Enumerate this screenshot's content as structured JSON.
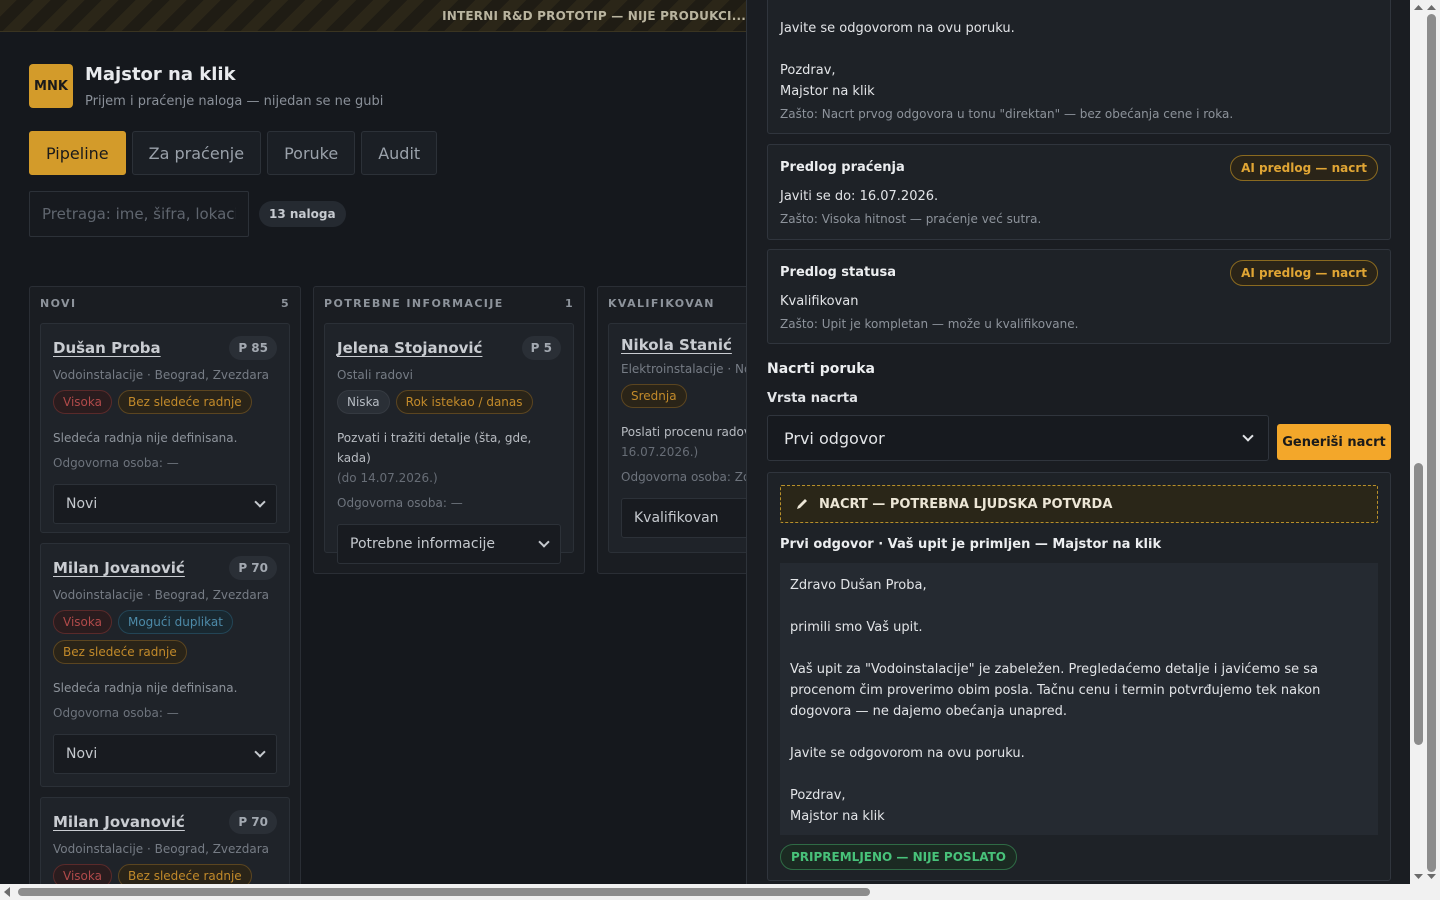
{
  "banner": {
    "text": "INTERNI R&D PROTOTIP — NIJE PRODUKCI..."
  },
  "header": {
    "logo": "MNK",
    "title": "Majstor na klik",
    "subtitle": "Prijem i praćenje naloga — nijedan se ne gubi"
  },
  "tabs": [
    {
      "label": "Pipeline",
      "active": true
    },
    {
      "label": "Za praćenje",
      "active": false
    },
    {
      "label": "Poruke",
      "active": false
    },
    {
      "label": "Audit",
      "active": false
    }
  ],
  "search": {
    "placeholder": "Pretraga: ime, šifra, lokaci",
    "count": "13 naloga"
  },
  "columns": [
    {
      "title": "NOVI",
      "count": "5",
      "cards": [
        {
          "name": "Dušan Proba",
          "priority": "P 85",
          "meta": "Vodoinstalacije · Beograd, Zvezdara",
          "tags": [
            {
              "label": "Visoka",
              "color": "#b04a4a"
            },
            {
              "label": "Bez sledeće radnje",
              "color": "#c28a2a"
            }
          ],
          "next": "Sledeća radnja nije definisana.",
          "owner": "Odgovorna osoba: —",
          "status": "Novi"
        },
        {
          "name": "Milan Jovanović",
          "priority": "P 70",
          "meta": "Vodoinstalacije · Beograd, Zvezdara",
          "tags": [
            {
              "label": "Visoka",
              "color": "#b04a4a"
            },
            {
              "label": "Mogući duplikat",
              "color": "#4d8aa8"
            },
            {
              "label": "Bez sledeće radnje",
              "color": "#c28a2a"
            }
          ],
          "next": "Sledeća radnja nije definisana.",
          "owner": "Odgovorna osoba: —",
          "status": "Novi"
        },
        {
          "name": "Milan Jovanović",
          "priority": "P 70",
          "meta": "Vodoinstalacije · Beograd, Zvezdara",
          "tags": [
            {
              "label": "Visoka",
              "color": "#b04a4a"
            },
            {
              "label": "Bez sledeće radnje",
              "color": "#c28a2a"
            }
          ]
        }
      ]
    },
    {
      "title": "POTREBNE INFORMACIJE",
      "count": "1",
      "cards": [
        {
          "name": "Jelena Stojanović",
          "priority": "P 5",
          "meta": "Ostali radovi",
          "tags": [
            {
              "label": "Niska",
              "color": "#b7bcc3"
            },
            {
              "label": "Rok istekao / danas",
              "color": "#c28a2a"
            }
          ],
          "next": "Pozvati i tražiti detalje (šta, gde, kada)",
          "next_date": "(do 14.07.2026.)",
          "owner": "Odgovorna osoba: —",
          "status": "Potrebne informacije"
        }
      ]
    },
    {
      "title": "KVALIFIKOVAN",
      "count": "",
      "cards": [
        {
          "name": "Nikola Stanić",
          "priority": "",
          "meta": "Elektroinstalacije · Nov",
          "tags": [
            {
              "label": "Srednja",
              "color": "#c28a2a"
            }
          ],
          "next": "Poslati procenu radov",
          "next_date": "16.07.2026.)",
          "owner": "Odgovorna osoba: Zo",
          "status": "Kvalifikovan"
        }
      ]
    }
  ],
  "panel": {
    "first_reply_tail": [
      "Javite se odgovorom na ovu poruku.",
      "Pozdrav,",
      "Majstor na klik"
    ],
    "first_reply_why": "Zašto: Nacrt prvog odgovora u tonu \"direktan\" — bez obećanja cene i roka.",
    "follow_up": {
      "title": "Predlog praćenja",
      "badge": "AI predlog — nacrt",
      "value": "Javiti se do: 16.07.2026.",
      "why": "Zašto: Visoka hitnost — praćenje već sutra."
    },
    "status": {
      "title": "Predlog statusa",
      "badge": "AI predlog — nacrt",
      "value": "Kvalifikovan",
      "why": "Zašto: Upit je kompletan — može u kvalifikovane."
    },
    "drafts_title": "Nacrti poruka",
    "draft_type_label": "Vrsta nacrta",
    "draft_type_value": "Prvi odgovor",
    "generate_button": "Generiši nacrt",
    "warning": "NACRT — POTREBNA LJUDSKA POTVRDA",
    "draft_heading": "Prvi odgovor · Vaš upit je primljen — Majstor na klik",
    "draft_lines": [
      "Zdravo Dušan Proba,",
      "",
      "primili smo Vaš upit.",
      "",
      "Vaš upit za \"Vodoinstalacije\" je zabeležen. Pregledaćemo detalje i javićemo se sa procenom čim proverimo obim posla. Tačnu cenu i termin potvrđujemo tek nakon dogovora — ne dajemo obećanja unapred.",
      "",
      "Javite se odgovorom na ovu poruku.",
      "",
      "Pozdrav,",
      "Majstor na klik"
    ],
    "sent_status": "PRIPREMLJENO — NIJE POSLATO"
  }
}
